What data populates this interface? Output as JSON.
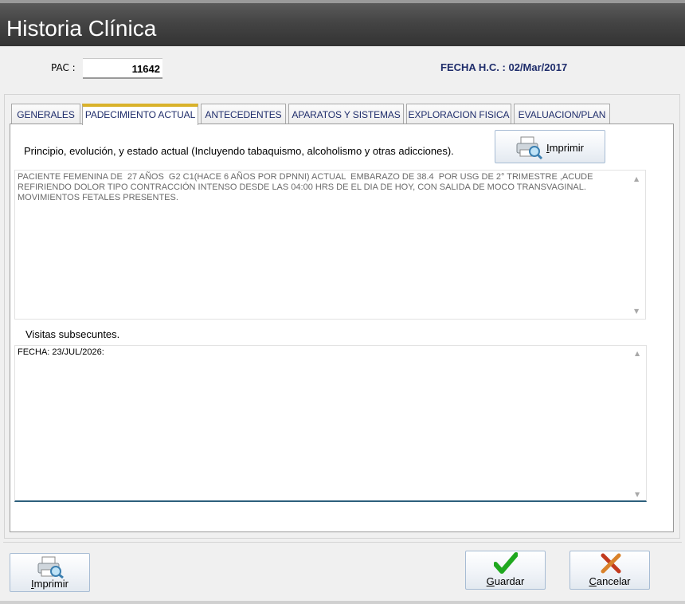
{
  "window": {
    "title": "Historia Clínica"
  },
  "header": {
    "pac_label": "PAC :",
    "pac_value": "11642",
    "fecha": "FECHA H.C. : 02/Mar/2017"
  },
  "tabs": [
    {
      "label": "GENERALES"
    },
    {
      "label": "PADECIMIENTO ACTUAL"
    },
    {
      "label": "ANTECEDENTES"
    },
    {
      "label": "APARATOS Y SISTEMAS"
    },
    {
      "label": "EXPLORACION FISICA"
    },
    {
      "label": "EVALUACION/PLAN"
    }
  ],
  "active_tab": "PADECIMIENTO ACTUAL",
  "padecimiento": {
    "section_label": "Principio, evolución, y estado actual (Incluyendo tabaquismo, alcoholismo y otras adicciones).",
    "print_button": "Imprimir",
    "text": "PACIENTE FEMENINA DE  27 AÑOS  G2 C1(HACE 6 AÑOS POR DPNNI) ACTUAL  EMBARAZO DE 38.4  POR USG DE 2° TRIMESTRE ,ACUDE\nREFIRIENDO DOLOR TIPO CONTRACCIÓN INTENSO DESDE LAS 04:00 HRS DE EL DIA DE HOY, CON SALIDA DE MOCO TRANSVAGINAL.\nMOVIMIENTOS FETALES PRESENTES."
  },
  "visitas": {
    "section_label": "Visitas subsecuntes.",
    "text": "FECHA: 23/JUL/2026:"
  },
  "footer": {
    "print_button": "Imprimir",
    "save_button": "Guardar",
    "cancel_button": "Cancelar"
  },
  "icons": [
    "printer-icon",
    "checkmark-icon",
    "cancel-x-icon",
    "scroll-up-arrow-icon",
    "scroll-down-arrow-icon"
  ],
  "colors": {
    "accent_tab": "#d9b22a",
    "label_text": "#1f2d6b",
    "save_check": "#1fa81f",
    "cancel_x": "#c23a1e"
  }
}
